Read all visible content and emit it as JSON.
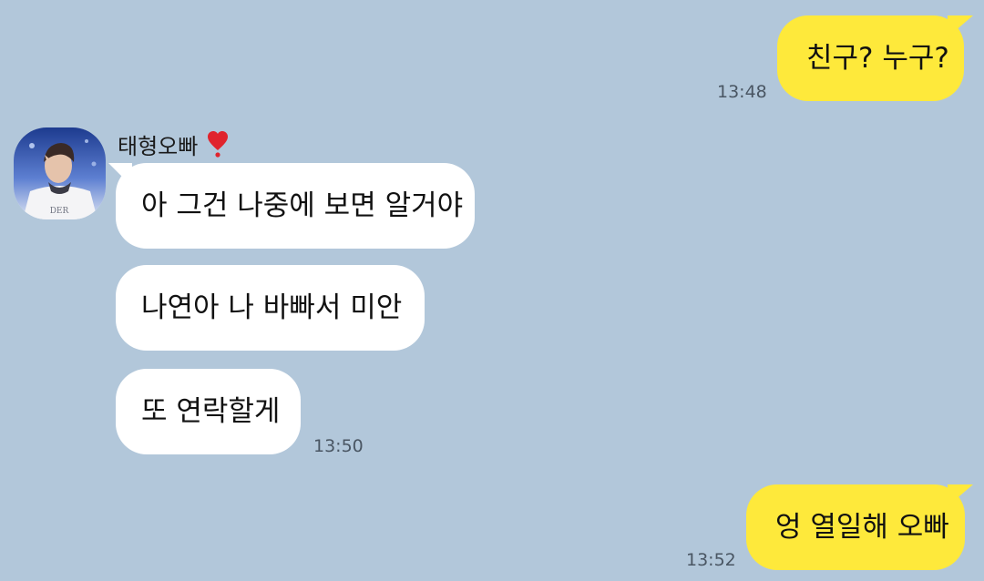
{
  "chat": {
    "contact": {
      "name": "태형오빠",
      "badge_icon": "red-heart-exclamation-icon",
      "avatar_icon": "profile-photo-avatar"
    },
    "messages": [
      {
        "side": "me",
        "text": "친구? 누구?",
        "time": "13:48"
      },
      {
        "side": "them",
        "text": "아 그건 나중에 보면 알거야"
      },
      {
        "side": "them",
        "text": "나연아 나 바빠서 미안"
      },
      {
        "side": "them",
        "text": "또 연락할게",
        "time": "13:50"
      },
      {
        "side": "me",
        "text": "엉 열일해 오빠",
        "time": "13:52"
      }
    ]
  },
  "colors": {
    "background": "#b2c7da",
    "my_bubble": "#fee93b",
    "their_bubble": "#ffffff",
    "heart": "#e0242d"
  }
}
